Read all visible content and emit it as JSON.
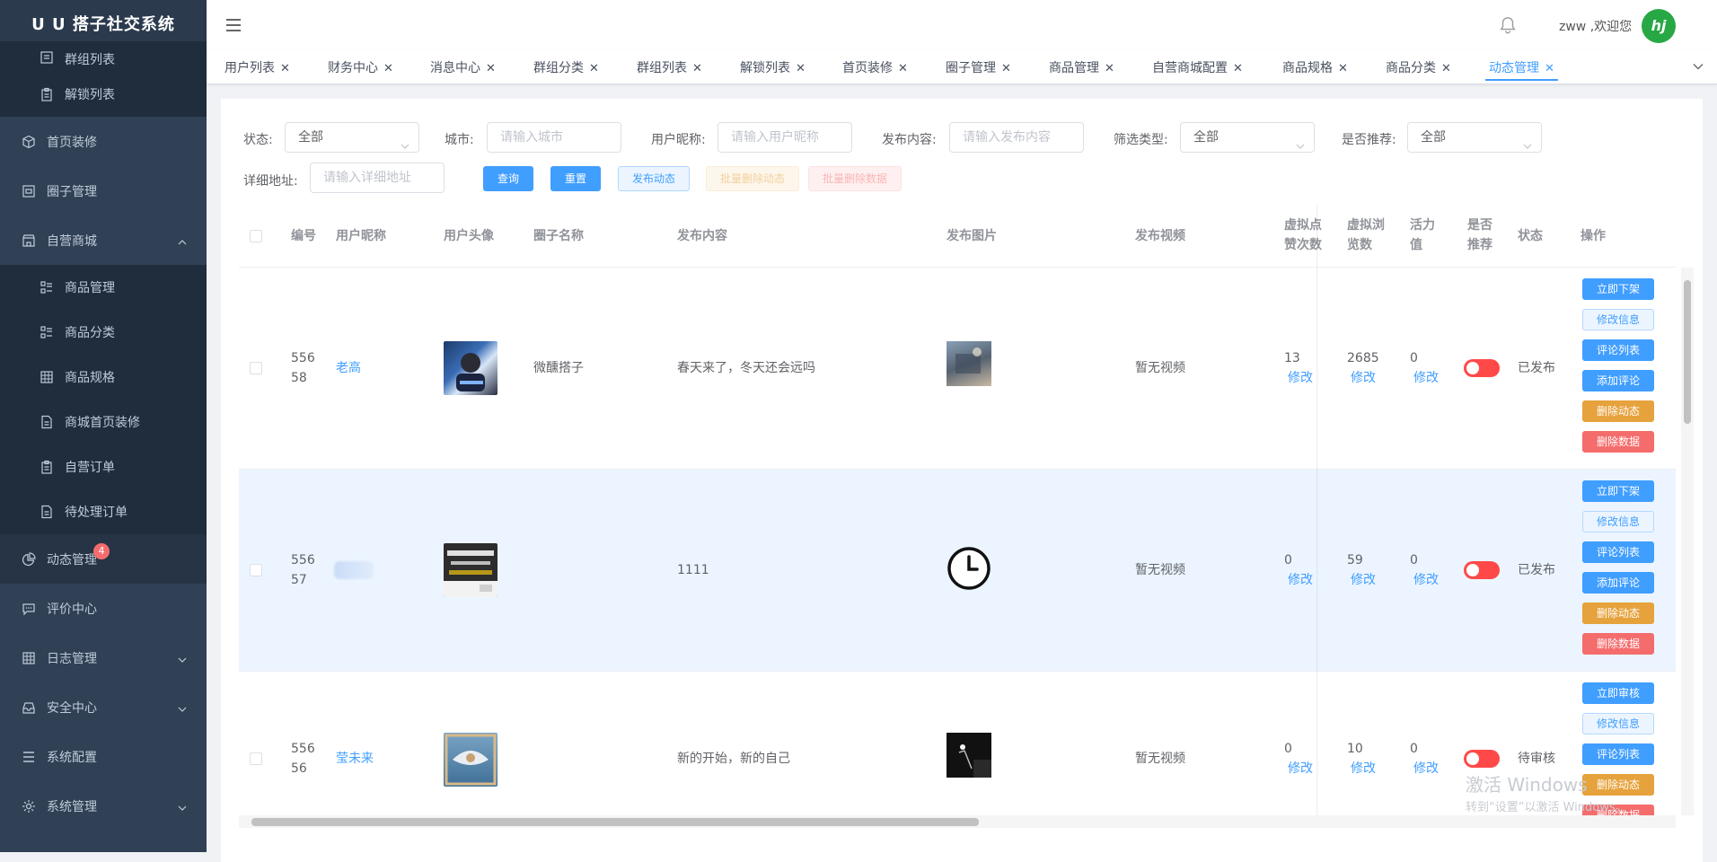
{
  "app": {
    "title": "U U 搭子社交系统"
  },
  "sidebar": {
    "items": [
      {
        "label": "群组列表",
        "icon": "list-icon",
        "sub": true
      },
      {
        "label": "解锁列表",
        "icon": "clipboard-icon",
        "sub": true
      },
      {
        "label": "首页装修",
        "icon": "cube-icon",
        "sub": false
      },
      {
        "label": "圈子管理",
        "icon": "picture-icon",
        "sub": false
      },
      {
        "label": "自营商城",
        "icon": "shop-icon",
        "sub": false,
        "arrow": "up"
      },
      {
        "label": "商品管理",
        "icon": "grid-list-icon",
        "sub": true
      },
      {
        "label": "商品分类",
        "icon": "grid-list-icon",
        "sub": true
      },
      {
        "label": "商品规格",
        "icon": "table-icon",
        "sub": true
      },
      {
        "label": "商城首页装修",
        "icon": "document-icon",
        "sub": true
      },
      {
        "label": "自营订单",
        "icon": "clipboard-icon",
        "sub": true
      },
      {
        "label": "待处理订单",
        "icon": "document-icon",
        "sub": true
      },
      {
        "label": "动态管理",
        "icon": "pie-chart-icon",
        "sub": false,
        "badge": "4"
      },
      {
        "label": "评价中心",
        "icon": "chat-icon",
        "sub": false
      },
      {
        "label": "日志管理",
        "icon": "table-icon",
        "sub": false,
        "arrow": "down"
      },
      {
        "label": "安全中心",
        "icon": "inbox-icon",
        "sub": false,
        "arrow": "down"
      },
      {
        "label": "系统配置",
        "icon": "menu-list-icon",
        "sub": false
      },
      {
        "label": "系统管理",
        "icon": "gear-icon",
        "sub": false,
        "arrow": "down"
      }
    ]
  },
  "navbar": {
    "welcome": "zww ,欢迎您",
    "avatar_text": "hj"
  },
  "tags": [
    {
      "label": "用户列表"
    },
    {
      "label": "财务中心"
    },
    {
      "label": "消息中心"
    },
    {
      "label": "群组分类"
    },
    {
      "label": "群组列表"
    },
    {
      "label": "解锁列表"
    },
    {
      "label": "首页装修"
    },
    {
      "label": "圈子管理"
    },
    {
      "label": "商品管理"
    },
    {
      "label": "自营商城配置"
    },
    {
      "label": "商品规格"
    },
    {
      "label": "商品分类"
    },
    {
      "label": "动态管理",
      "active": true
    }
  ],
  "filters": {
    "status_label": "状态:",
    "status_value": "全部",
    "city_label": "城市:",
    "city_placeholder": "请输入城市",
    "nickname_label": "用户昵称:",
    "nickname_placeholder": "请输入用户昵称",
    "content_label": "发布内容:",
    "content_placeholder": "请输入发布内容",
    "type_label": "筛选类型:",
    "type_value": "全部",
    "recommend_label": "是否推荐:",
    "recommend_value": "全部",
    "address_label": "详细地址:",
    "address_placeholder": "请输入详细地址"
  },
  "buttons": {
    "query": "查询",
    "reset": "重置",
    "publish": "发布动态",
    "batch_delete_dynamic": "批量删除动态",
    "batch_delete_data": "批量删除数据"
  },
  "table": {
    "headers": {
      "id": "编号",
      "nickname": "用户昵称",
      "avatar": "用户头像",
      "circle": "圈子名称",
      "content": "发布内容",
      "images": "发布图片",
      "video": "发布视频",
      "likes_1": "虚拟点",
      "likes_2": "赞次数",
      "views_1": "虚拟浏",
      "views_2": "览数",
      "vitality_1": "活力",
      "vitality_2": "值",
      "recommend_1": "是否",
      "recommend_2": "推荐",
      "status": "状态",
      "actions": "操作"
    },
    "edit_label": "修改",
    "rows": [
      {
        "id_1": "556",
        "id_2": "58",
        "nickname": "老高",
        "circle": "微醺搭子",
        "content": "春天来了，冬天还会远吗",
        "video": "暂无视频",
        "likes": "13",
        "views": "2685",
        "vitality": "0",
        "status": "已发布",
        "actions": [
          "立即下架",
          "修改信息",
          "评论列表",
          "添加评论",
          "删除动态",
          "删除数据"
        ]
      },
      {
        "id_1": "556",
        "id_2": "57",
        "nickname": "",
        "circle": "",
        "content": "1111",
        "video": "暂无视频",
        "likes": "0",
        "views": "59",
        "vitality": "0",
        "status": "已发布",
        "actions": [
          "立即下架",
          "修改信息",
          "评论列表",
          "添加评论",
          "删除动态",
          "删除数据"
        ]
      },
      {
        "id_1": "556",
        "id_2": "56",
        "nickname": "莹未来",
        "circle": "",
        "content": "新的开始，新的自己",
        "video": "暂无视频",
        "likes": "0",
        "views": "10",
        "vitality": "0",
        "status": "待审核",
        "actions": [
          "立即审核",
          "修改信息",
          "评论列表",
          "删除动态",
          "删除数据"
        ]
      }
    ]
  },
  "watermark": {
    "line1": "激活 Windows",
    "line2": "转到“设置”以激活 Windows。"
  },
  "colors": {
    "primary": "#409eff",
    "sidebar": "#304156",
    "danger": "#f56c6c",
    "warning": "#e6a23c"
  }
}
